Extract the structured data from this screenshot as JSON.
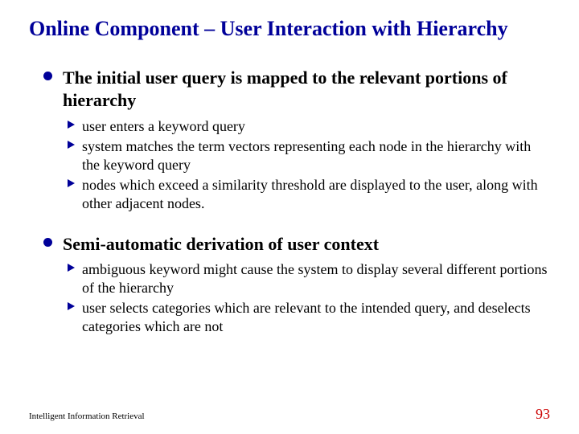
{
  "title": "Online Component – User Interaction with Hierarchy",
  "bullets": [
    {
      "text": "The initial user query is mapped to the relevant portions of hierarchy",
      "sub": [
        "user enters a keyword query",
        "system matches the term vectors representing each node in the hierarchy with the keyword query",
        "nodes which exceed a similarity threshold are displayed to the user, along with other adjacent nodes."
      ]
    },
    {
      "text": "Semi-automatic derivation of user context",
      "sub": [
        "ambiguous keyword might cause the system to display several different portions of the hierarchy",
        "user selects categories which are relevant to the intended query, and deselects categories which are not"
      ]
    }
  ],
  "footer": {
    "left": "Intelligent Information Retrieval",
    "page": "93"
  }
}
